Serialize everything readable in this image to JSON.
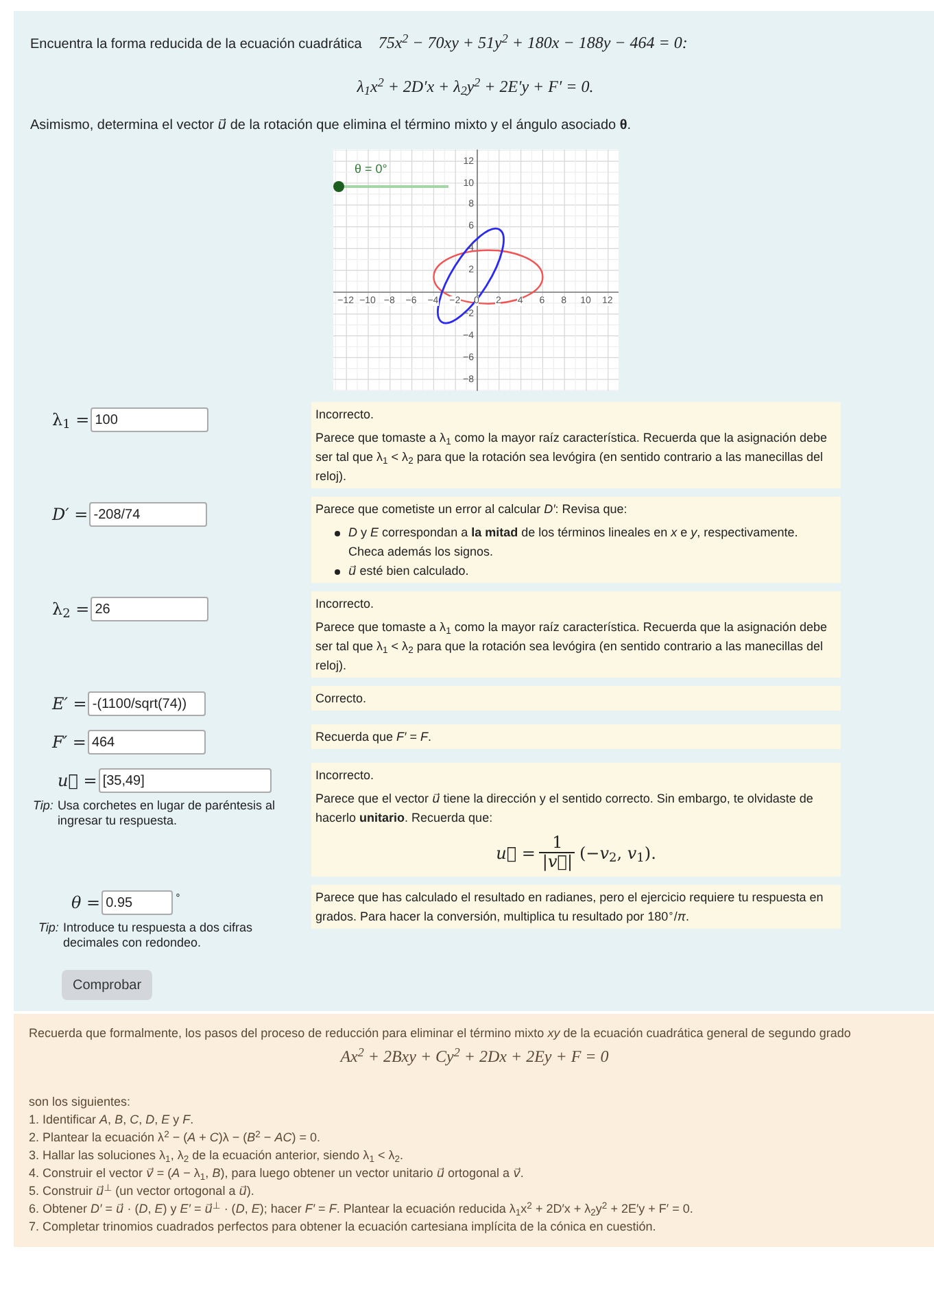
{
  "question": {
    "intro": "Encuentra la forma reducida de la ecuación cuadrática",
    "equation": "75x$^{2}$ − 70xy + 51y$^{2}$ + 180x − 188y − 464 = 0:",
    "reduced_form": "λ$_{1}$x$^{2}$ + 2D′x + λ$_{2}$y$^{2}$ + 2E′y + F′ = 0.",
    "instruction": "Asimismo, determina el vector *u⃗* de la rotación que elimina el término mixto y el ángulo  asociado **θ**."
  },
  "graph": {
    "slider_label": "θ = 0°",
    "slider": {
      "level": 0
    },
    "x_ticks": [
      "−12",
      "−10",
      "−8",
      "−6",
      "−4",
      "−2",
      "0",
      "2",
      "4",
      "6",
      "8",
      "10",
      "12"
    ],
    "y_ticks": [
      "12",
      "10",
      "8",
      "6",
      "4",
      "2",
      "−2",
      "−4",
      "−6",
      "−8"
    ]
  },
  "answers": [
    {
      "label": "λ$_{1}$ =",
      "value": "100",
      "feedback": [
        {
          "kind": "text",
          "text": "Incorrecto."
        },
        {
          "kind": "text",
          "text": "Parece que tomaste a λ$_{1}$ como la mayor raíz característica. Recuerda que la asignación debe ser tal que λ$_{1}$ < λ$_{2}$ para que la rotación sea levógira (en sentido contrario a las manecillas del reloj)."
        }
      ]
    },
    {
      "label": "*D′* =",
      "value": "-208/74",
      "feedback": [
        {
          "kind": "text",
          "text": "Parece que cometiste un error al calcular *D′*: Revisa que:"
        },
        {
          "kind": "bullets",
          "items": [
            "*D* y *E* correspondan a **la mitad** de los términos lineales en *x* e *y*, respectivamente. Checa además los signos.",
            "*u⃗* esté bien calculado."
          ]
        }
      ]
    },
    {
      "label": "λ$_{2}$ =",
      "value": "26",
      "feedback": [
        {
          "kind": "text",
          "text": "Incorrecto."
        },
        {
          "kind": "text",
          "text": "Parece que tomaste a λ$_{1}$ como la mayor raíz característica. Recuerda que la asignación debe ser tal que λ$_{1}$ < λ$_{2}$ para que la rotación sea levógira (en sentido contrario a las manecillas del reloj)."
        }
      ]
    },
    {
      "label": "*E′* =",
      "value": "-(1100/sqrt(74))",
      "feedback": [
        {
          "kind": "text",
          "text": "Correcto."
        }
      ]
    },
    {
      "label": "*F′* =",
      "value": "464",
      "feedback": [
        {
          "kind": "text",
          "text": "Recuerda que *F′* = *F*."
        }
      ]
    },
    {
      "label": "*u⃗* =",
      "value": "[35,49]",
      "tip": {
        "label": "Tip:",
        "text": "Usa corchetes en lugar de paréntesis al ingresar tu respuesta."
      },
      "feedback": [
        {
          "kind": "text",
          "text": "Incorrecto."
        },
        {
          "kind": "text",
          "text": "Parece que el vector *u⃗* tiene la dirección y el sentido correcto. Sin embargo, te olvidaste de hacerlo **unitario**. Recuerda que:"
        },
        {
          "kind": "fraction",
          "lhs": "*u⃗* =",
          "numerator": "1",
          "denominator": "|*v⃗*|",
          "rhs": "(−*v*$_{2}$, *v*$_{1}$)."
        }
      ]
    },
    {
      "label": "*θ* =",
      "value": "0.95",
      "unit": "°",
      "tip": {
        "label": "Tip:",
        "text": "Introduce tu respuesta a dos cifras decimales con redondeo."
      },
      "feedback": [
        {
          "kind": "text",
          "text": "Parece que has calculado el resultado en radianes, pero el ejercicio requiere tu respuesta en grados. Para hacer la conversión, multiplica tu resultado por 180$^{∘}$/*π*."
        }
      ]
    }
  ],
  "check_button": "Comprobar",
  "summary": {
    "intro": "Recuerda que formalmente, los pasos del proceso de reducción para eliminar el término mixto *xy* de la ecuación cuadrática general de segundo grado",
    "formula": "Ax$^{2}$ + 2Bxy + Cy$^{2}$ + 2Dx + 2Ey + F = 0",
    "lead": "son los siguientes:",
    "steps": [
      "1. Identificar *A*, *B*, *C*, *D*, *E* y *F*.",
      "2. Plantear la ecuación λ$^{2}$ − (*A* + *C*)λ − (*B*$^{2}$ − *AC*) = 0.",
      "3. Hallar las soluciones λ$_{1}$, λ$_{2}$ de la ecuación anterior, siendo λ$_{1}$ < λ$_{2}$.",
      "4. Construir el vector *v⃗* = (*A* − λ$_{1}$, *B*), para luego obtener un vector unitario *u⃗* ortogonal a *v⃗*.",
      "5. Construir *u⃗*$^{⊥}$ (un vector ortogonal a *u⃗*).",
      "6. Obtener *D′* = *u⃗* · (*D*, *E*) y *E′* = *u⃗*$^{⊥}$ · (*D*, *E*); hacer *F′* = *F*. Plantear la ecuación reducida λ$_{1}$x$^{2}$ + 2D′x + λ$_{2}$y$^{2}$ + 2E′y + F′ = 0.",
      "7. Completar trinomios cuadrados perfectos para obtener la ecuación cartesiana implícita de la cónica en cuestión."
    ]
  }
}
